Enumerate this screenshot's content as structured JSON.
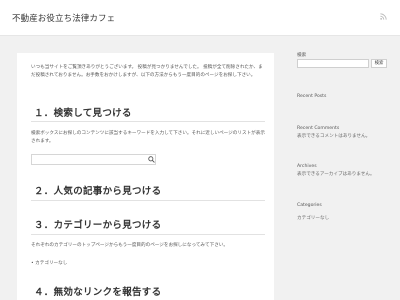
{
  "header": {
    "site_title": "不動産お役立ち法律カフェ",
    "rss_icon": "rss-icon"
  },
  "main": {
    "intro": "いつも当サイトをご覧頂きありがとうございます。 投稿が見つかりませんでした。 投稿が全て削除されたか、まだ投稿されておりません。お手数をおかけしますが、以下の方法からもう一度目的のページをお探し下さい。",
    "sections": [
      {
        "heading": "１．検索して見つける",
        "text": "検索ボックスにお探しのコンテンツに該当するキーワードを入力して下さい。それに近しいページのリストが表示されます。"
      },
      {
        "heading": "２．人気の記事から見つける",
        "text": ""
      },
      {
        "heading": "３．カテゴリーから見つける",
        "text": "それぞれのカテゴリーのトップページからもう一度目的のページをお探しになってみて下さい。",
        "bullet": "カテゴリーなし"
      },
      {
        "heading": "４．無効なリンクを報告する",
        "text": ""
      }
    ],
    "search_placeholder": "",
    "search_icon": "search-icon"
  },
  "sidebar": {
    "search_label": "検索",
    "search_button": "検索",
    "recent_posts_title": "Recent Posts",
    "recent_comments_title": "Recent Comments",
    "recent_comments_text": "表示できるコメントはありません。",
    "archives_title": "Archives",
    "archives_text": "表示できるアーカイブはありません。",
    "categories_title": "Categories",
    "categories_item": "カテゴリーなし"
  },
  "colors": {
    "page_background": "#f1f1f1",
    "panel_background": "#ffffff",
    "text": "#333333"
  }
}
